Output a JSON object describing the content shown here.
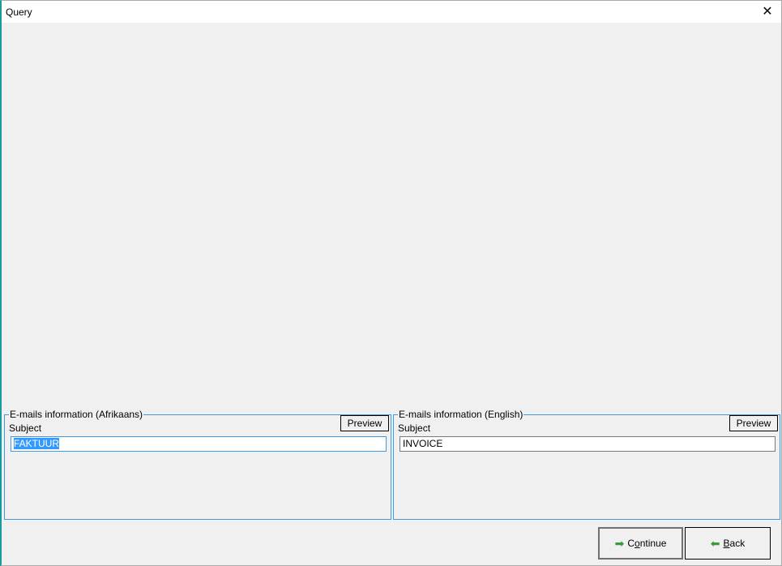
{
  "window": {
    "title": "Query"
  },
  "afrikaans": {
    "legend": "E-mails information (Afrikaans)",
    "subject_label": "Subject",
    "subject_value": "FAKTUUR",
    "preview": "Preview"
  },
  "english": {
    "legend": "E-mails information (English)",
    "subject_label": "Subject",
    "subject_value": "INVOICE",
    "preview": "Preview"
  },
  "buttons": {
    "continue_pre": "C",
    "continue_ul": "o",
    "continue_post": "ntinue",
    "back_ul": "B",
    "back_post": "ack"
  }
}
